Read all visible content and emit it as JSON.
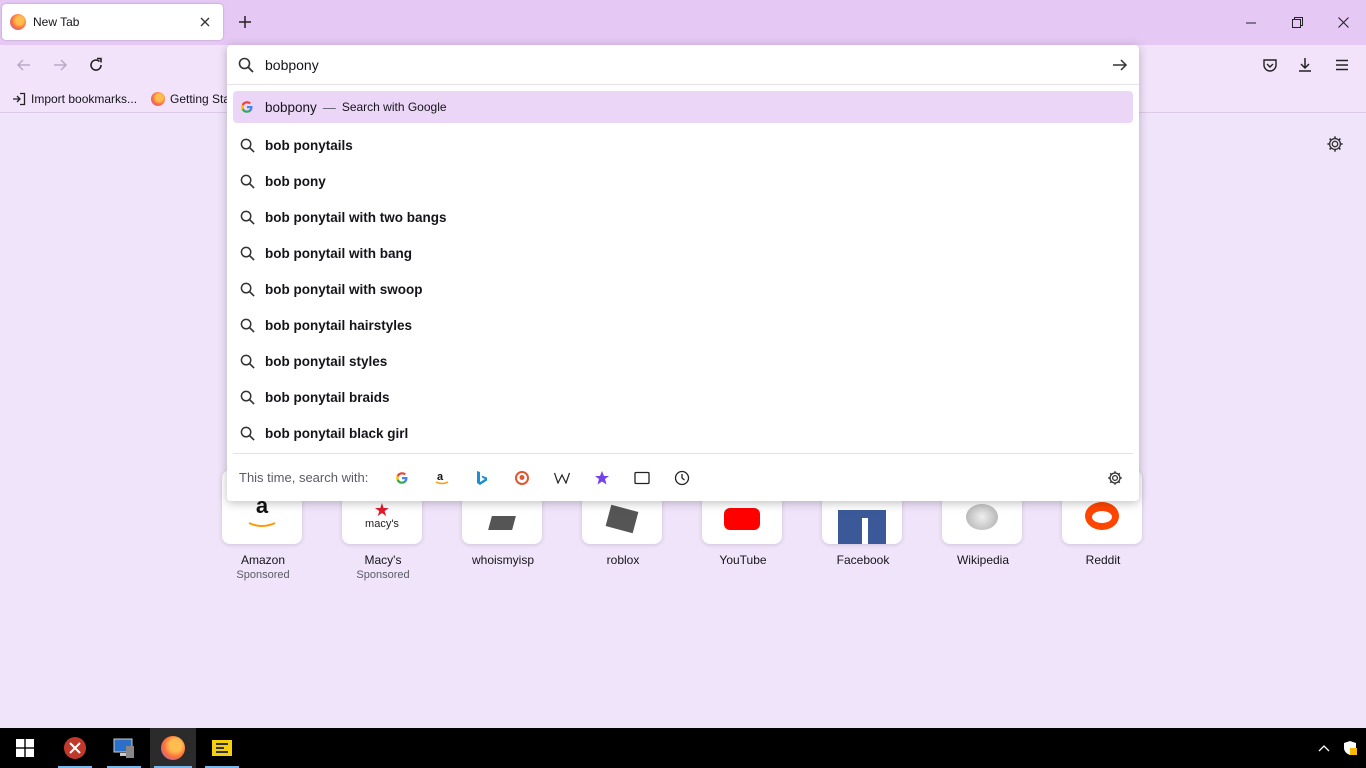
{
  "tab": {
    "title": "New Tab"
  },
  "bookmarks": [
    {
      "label": "Import bookmarks..."
    },
    {
      "label": "Getting Sta"
    }
  ],
  "urlbar": {
    "value": "bobpony",
    "heuristic": {
      "text": "bobpony",
      "separator": "—",
      "action": "Search with Google"
    },
    "suggestions": [
      "bob ponytails",
      "bob pony",
      "bob ponytail with two bangs",
      "bob ponytail with bang",
      "bob ponytail with swoop",
      "bob ponytail hairstyles",
      "bob ponytail styles",
      "bob ponytail braids",
      "bob ponytail black girl"
    ],
    "oneoff_label": "This time, search with:",
    "engines": [
      "google",
      "amazon",
      "bing",
      "duckduckgo",
      "wikipedia",
      "bookmarks",
      "tabs",
      "history"
    ]
  },
  "top_sites": [
    {
      "label": "Amazon",
      "sub": "Sponsored"
    },
    {
      "label": "Macy's",
      "sub": "Sponsored"
    },
    {
      "label": "whoismyisp",
      "sub": ""
    },
    {
      "label": "roblox",
      "sub": ""
    },
    {
      "label": "YouTube",
      "sub": ""
    },
    {
      "label": "Facebook",
      "sub": ""
    },
    {
      "label": "Wikipedia",
      "sub": ""
    },
    {
      "label": "Reddit",
      "sub": ""
    }
  ],
  "tile_logo_text": {
    "amazon": "a",
    "macys": "macy's"
  },
  "colors": {
    "accent": "#e6c8f5",
    "selected_row": "#ecd6f8",
    "page_bg": "#f0e4fb"
  }
}
